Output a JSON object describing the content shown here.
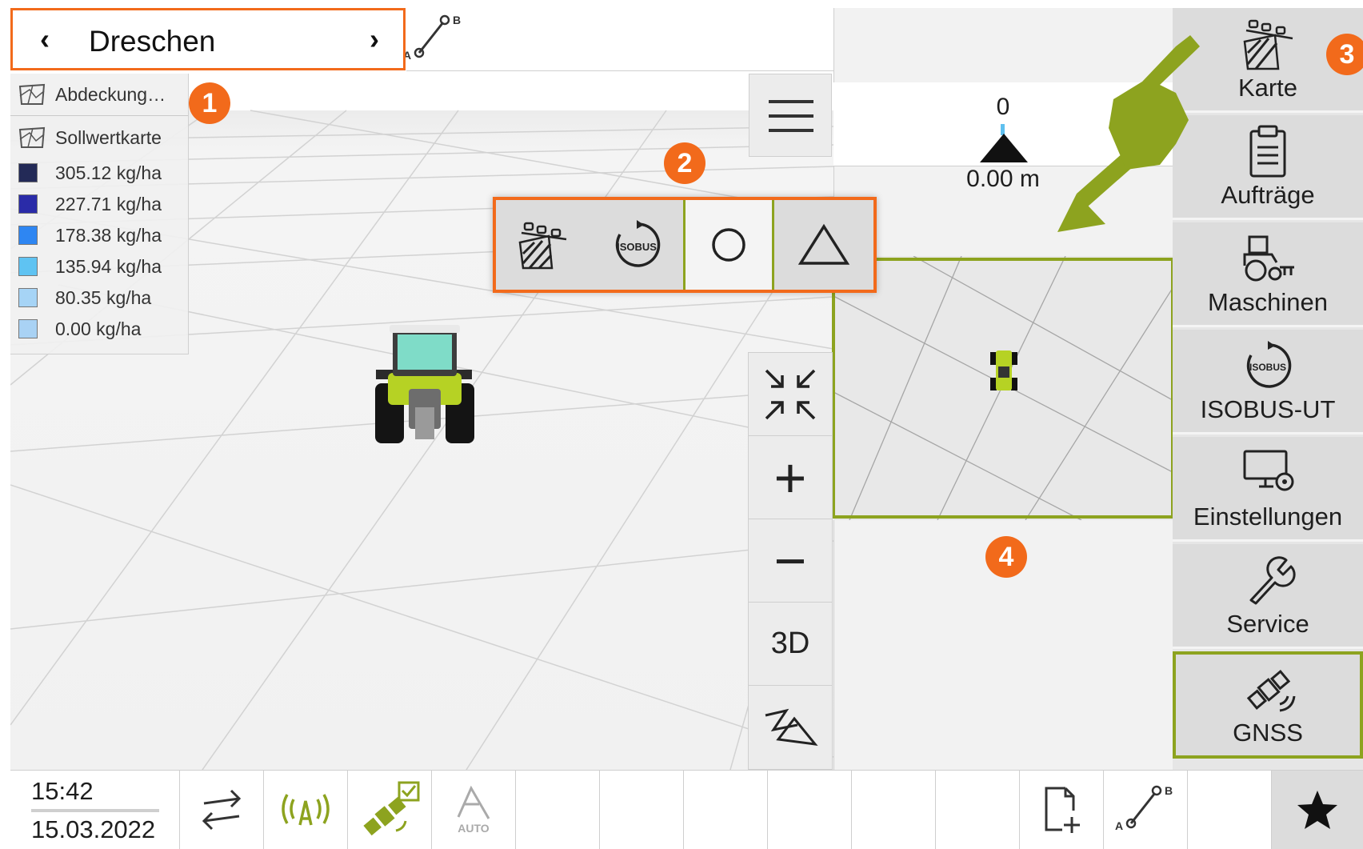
{
  "header": {
    "mode_title": "Dreschen",
    "prev_label": "‹",
    "next_label": "›",
    "ab_line_icon": "ab-line-icon",
    "ab_a": "A",
    "ab_b": "B"
  },
  "legend": {
    "coverage_label": "Abdeckung…",
    "setpoint_label": "Sollwertkarte",
    "entries": [
      {
        "value": "305.12 kg/ha",
        "color": "#232a57"
      },
      {
        "value": "227.71 kg/ha",
        "color": "#2a2ba8"
      },
      {
        "value": "178.38 kg/ha",
        "color": "#2e86f2"
      },
      {
        "value": "135.94 kg/ha",
        "color": "#5fc3f2"
      },
      {
        "value": "80.35 kg/ha",
        "color": "#a6d4f6"
      },
      {
        "value": "0.00 kg/ha",
        "color": "#a9d2f4"
      }
    ]
  },
  "deviation": {
    "top_value": "0",
    "distance": "0.00 m"
  },
  "view_toolbar": {
    "buttons": [
      "field-map-icon",
      "isobus-icon",
      "circle-icon",
      "triangle-icon"
    ],
    "isobus_text": "ISOBUS",
    "selected_index": 2
  },
  "zoom": {
    "fit_icon": "collapse-arrows-icon",
    "zoom_in": "+",
    "zoom_out": "−",
    "view_3d": "3D",
    "perspective_icon": "perspective-icon"
  },
  "sidebar": {
    "items": [
      {
        "label": "Karte",
        "icon": "map-icon"
      },
      {
        "label": "Aufträge",
        "icon": "clipboard-icon"
      },
      {
        "label": "Maschinen",
        "icon": "tractor-icon"
      },
      {
        "label": "ISOBUS-UT",
        "icon": "isobus-icon"
      },
      {
        "label": "Einstellungen",
        "icon": "monitor-gear-icon"
      },
      {
        "label": "Service",
        "icon": "wrench-icon"
      },
      {
        "label": "GNSS",
        "icon": "satellite-icon"
      }
    ],
    "selected": "GNSS"
  },
  "annotations": [
    "1",
    "2",
    "3",
    "4"
  ],
  "bottom_bar": {
    "time": "15:42",
    "date": "15.03.2022",
    "auto_label": "AUTO",
    "icons": [
      "swap-icon",
      "antenna-signal-icon",
      "satellite-check-icon",
      "auto-steer-icon",
      "new-file-icon",
      "ab-line-icon",
      "star-icon"
    ]
  },
  "colors": {
    "accent_orange": "#f26a1b",
    "accent_green": "#8da31f",
    "panel_gray": "#dcdcdc"
  }
}
